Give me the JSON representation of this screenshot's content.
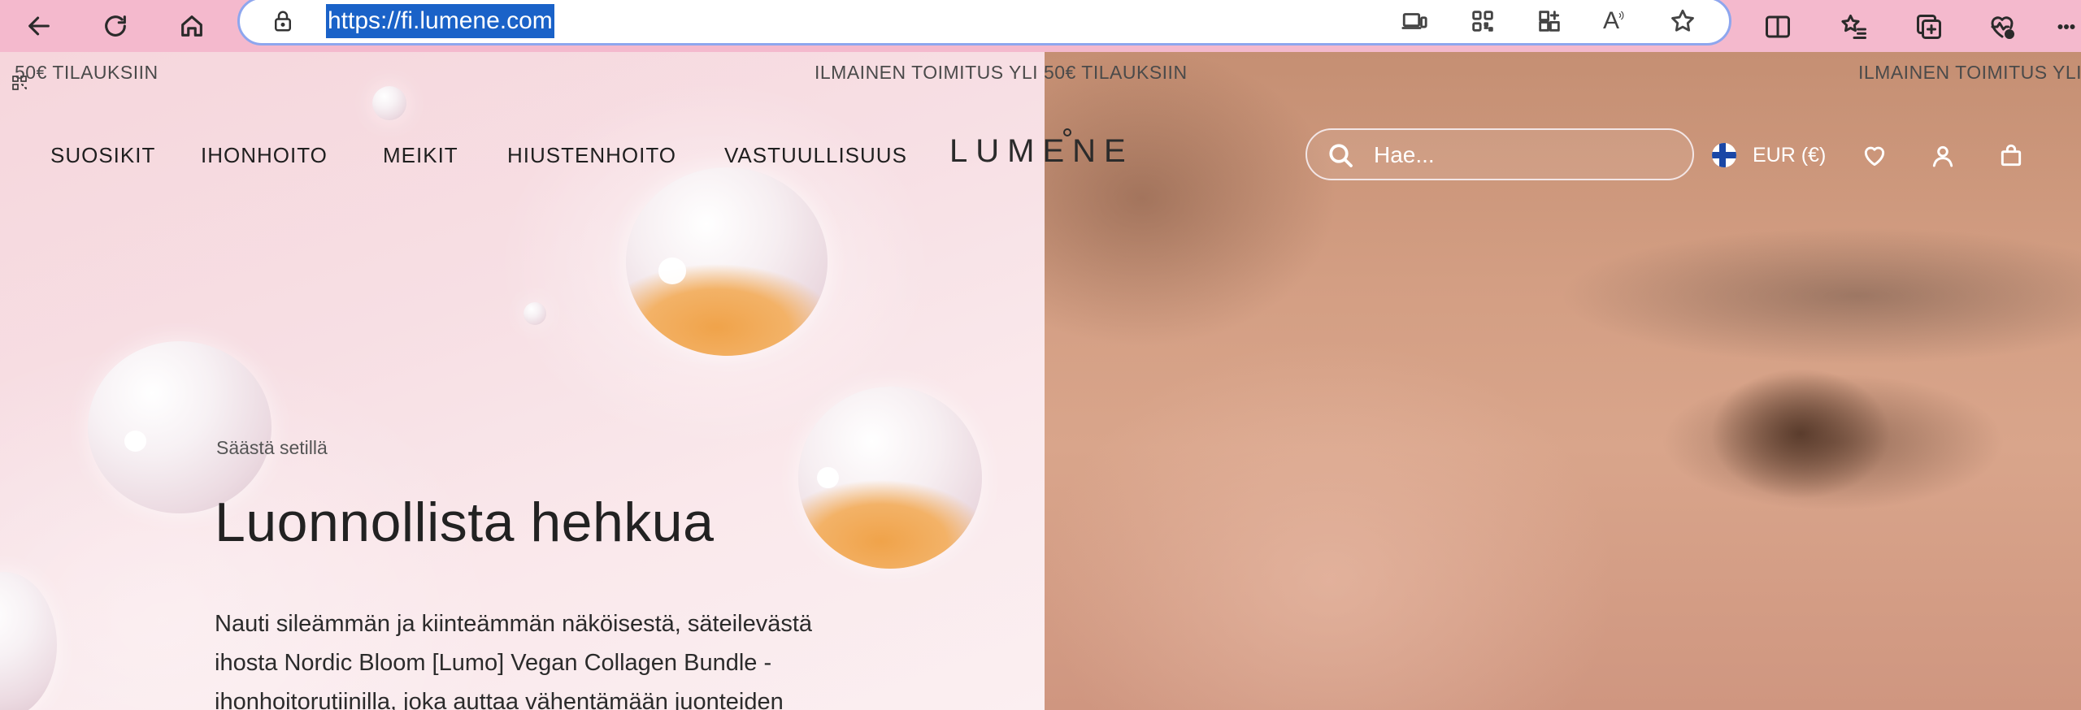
{
  "browser": {
    "url": "https://fi.lumene.com"
  },
  "announcement": {
    "fragment_left": "50€ TILAUKSIIN",
    "fragment_center": "ILMAINEN TOIMITUS YLI 50€ TILAUKSIIN",
    "fragment_right": "ILMAINEN TOIMITUS YLI"
  },
  "nav": {
    "items": [
      "SUOSIKIT",
      "IHONHOITO",
      "MEIKIT",
      "HIUSTENHOITO",
      "VASTUULLISUUS"
    ],
    "logo": "LUMENE"
  },
  "search": {
    "placeholder": "Hae..."
  },
  "header_actions": {
    "currency": "EUR (€)"
  },
  "hero": {
    "eyebrow": "Säästä setillä",
    "headline": "Luonnollista hehkua",
    "body_lines": [
      "Nauti sileämmän ja kiinteämmän näköisestä, säteilevästä",
      "ihosta Nordic Bloom [Lumo] Vegan Collagen Bundle -",
      "ihonhoitorutiinilla, joka auttaa vähentämään juonteiden"
    ]
  },
  "icons": {
    "back": "arrow-left-icon",
    "refresh": "refresh-icon",
    "home": "home-icon",
    "lock": "lock-icon",
    "search": "search-icon",
    "wishlist": "heart-icon",
    "account": "user-icon",
    "bag": "shopping-bag-icon"
  },
  "colors": {
    "chrome_bg": "#f4b9cd",
    "address_highlight": "#1a62c8",
    "address_border": "#8ea6ee"
  }
}
